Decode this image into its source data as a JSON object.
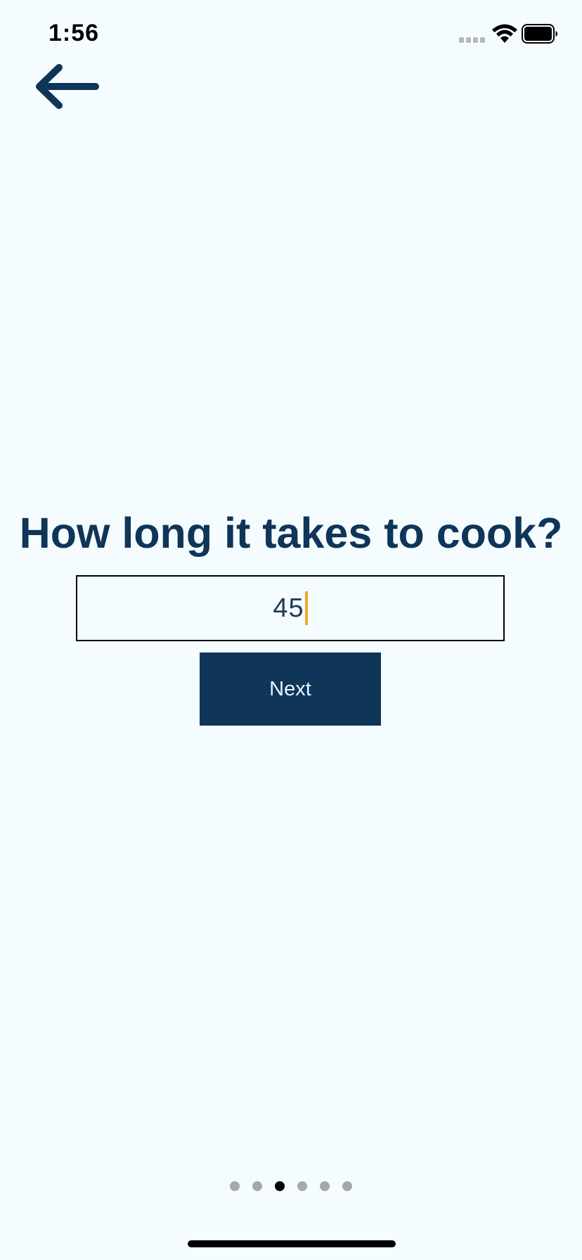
{
  "status_bar": {
    "time": "1:56",
    "icons": [
      "cellular-signal-icon",
      "wifi-icon",
      "battery-icon"
    ]
  },
  "nav": {
    "back_icon": "arrow-left-icon"
  },
  "question": {
    "title": "How long it takes to cook?"
  },
  "cook_time_input": {
    "value": "45",
    "caret_color": "#f5a623"
  },
  "next_button": {
    "label": "Next"
  },
  "pagination": {
    "total_pages": 6,
    "current_page": 3
  },
  "colors": {
    "primary": "#0f3558",
    "background": "#f5fcff",
    "accent": "#f5a623"
  }
}
